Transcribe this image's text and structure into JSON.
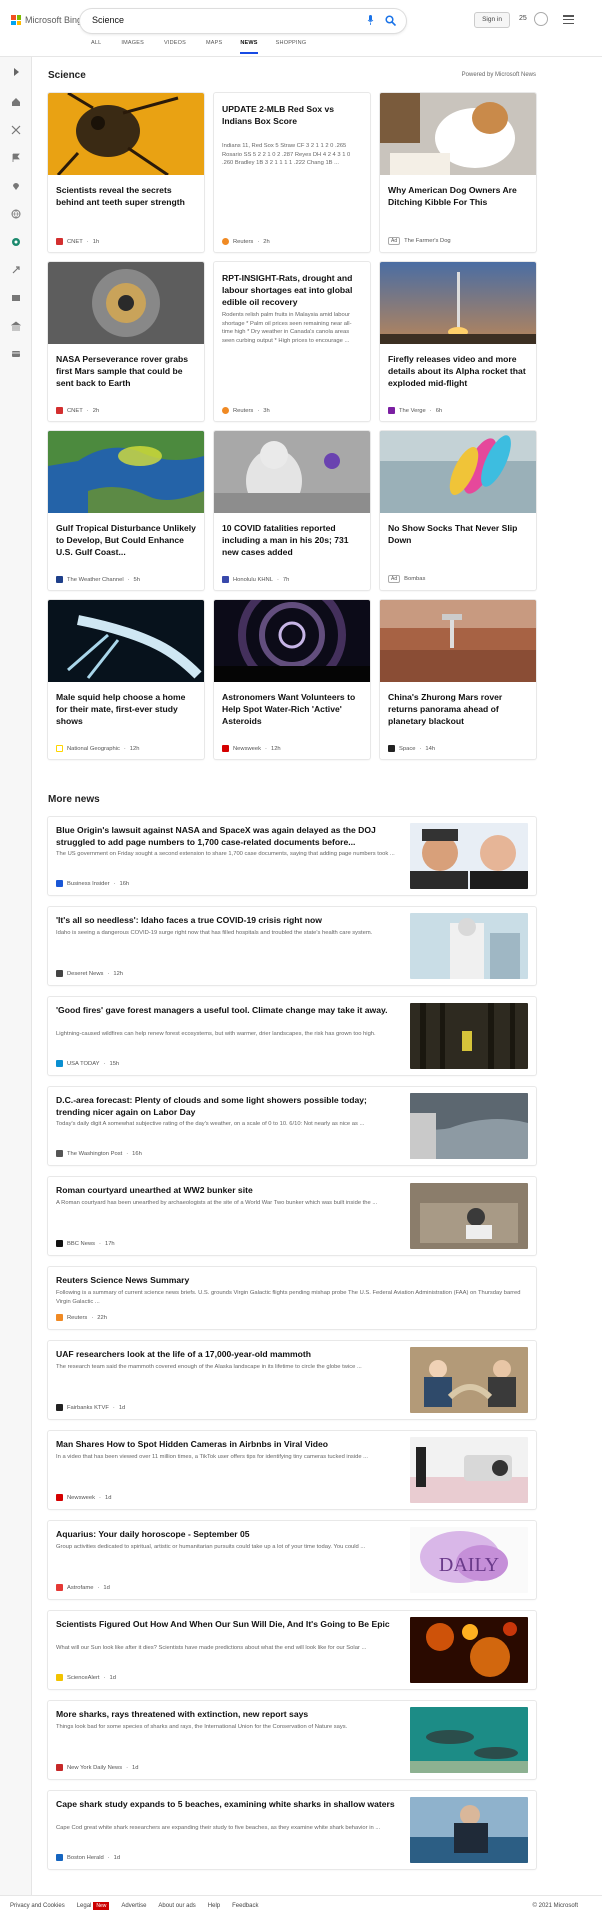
{
  "brand": {
    "name": "Microsoft Bing"
  },
  "search": {
    "query": "Science"
  },
  "header": {
    "signin": "Sign in",
    "rewards": "25"
  },
  "tabs": [
    "ALL",
    "IMAGES",
    "VIDEOS",
    "MAPS",
    "NEWS",
    "SHOPPING"
  ],
  "active_tab": "NEWS",
  "section": {
    "title": "Science",
    "powered": "Powered by Microsoft News"
  },
  "cards": [
    {
      "title": "Scientists reveal the secrets behind ant teeth super strength",
      "source": "CNET",
      "time": "1h",
      "icon_color": "#d32f2f"
    },
    {
      "title": "UPDATE 2-MLB Red Sox vs Indians Box Score",
      "snippet": "Indians 11, Red Sox 5 Straw CF 3 2 1 1 2 0 .265 Rosario SS 5 2 2 1 0 2 .287 Reyes DH 4 2 4 3 1 0 .260 Bradley 1B 3 2 1 1 1 1 .222 Chang 1B ...",
      "source": "Reuters",
      "time": "2h",
      "icon_color": "#f08a24"
    },
    {
      "title": "Why American Dog Owners Are Ditching Kibble For This",
      "ad": "Ad",
      "source": "The Farmer's Dog",
      "time": ""
    },
    {
      "title": "NASA Perseverance rover grabs first Mars sample that could be sent back to Earth",
      "source": "CNET",
      "time": "2h",
      "icon_color": "#d32f2f"
    },
    {
      "title": "RPT-INSIGHT-Rats, drought and labour shortages eat into global edible oil recovery",
      "snippet": "Rodents relish palm fruits in Malaysia amid labour shortage * Palm oil prices seen remaining near all-time high * Dry weather in Canada's canola areas seen curbing output * High prices to encourage ...",
      "source": "Reuters",
      "time": "3h",
      "icon_color": "#f08a24"
    },
    {
      "title": "Firefly releases video and more details about its Alpha rocket that exploded mid-flight",
      "source": "The Verge",
      "time": "6h",
      "icon_color": "#7b1fa2"
    },
    {
      "title": "Gulf Tropical Disturbance Unlikely to Develop, But Could Enhance U.S. Gulf Coast...",
      "source": "The Weather Channel",
      "time": "5h",
      "icon_color": "#1e3f8a"
    },
    {
      "title": "10 COVID fatalities reported including a man in his 20s; 731 new cases added",
      "source": "Honolulu KHNL",
      "time": "7h",
      "icon_color": "#3949ab"
    },
    {
      "title": "No Show Socks That Never Slip Down",
      "ad": "Ad",
      "source": "Bombas",
      "time": ""
    },
    {
      "title": "Male squid help choose a home for their mate, first-ever study shows",
      "source": "National Geographic",
      "time": "12h",
      "icon_color": "#ffd600"
    },
    {
      "title": "Astronomers Want Volunteers to Help Spot Water-Rich 'Active' Asteroids",
      "source": "Newsweek",
      "time": "12h",
      "icon_color": "#d50000"
    },
    {
      "title": "China's Zhurong Mars rover returns panorama ahead of planetary blackout",
      "source": "Space",
      "time": "14h",
      "icon_color": "#222222"
    }
  ],
  "more_news_title": "More news",
  "news": [
    {
      "title": "Blue Origin's lawsuit against NASA and SpaceX was again delayed as the DOJ struggled to add page numbers to 1,700 case-related documents before...",
      "snippet": "The US government on Friday sought a second extension to share 1,700 case documents, saying that adding page numbers took ...",
      "source": "Business Insider",
      "time": "16h",
      "icon_color": "#1a57d6"
    },
    {
      "title": "'It's all so needless': Idaho faces a true COVID-19 crisis right now",
      "snippet": "Idaho is seeing a dangerous COVID-19 surge right now that has filled hospitals and troubled the state's health care system.",
      "source": "Deseret News",
      "time": "12h",
      "icon_color": "#444444"
    },
    {
      "title": "'Good fires' gave forest managers a useful tool. Climate change may take it away.",
      "snippet": "Lightning-caused wildfires can help renew forest ecosystems, but with warmer, drier landscapes, the risk has grown too high.",
      "source": "USA TODAY",
      "time": "15h",
      "icon_color": "#0a8fd1"
    },
    {
      "title": "D.C.-area forecast: Plenty of clouds and some light showers possible today; trending nicer again on Labor Day",
      "snippet": "Today's daily digit A somewhat subjective rating of the day's weather, on a scale of 0 to 10. 6/10: Not nearly as nice as ...",
      "source": "The Washington Post",
      "time": "16h",
      "icon_color": "#555555"
    },
    {
      "title": "Roman courtyard unearthed at WW2 bunker site",
      "snippet": "A Roman courtyard has been unearthed by archaeologists at the site of a World War Two bunker which was built inside the ...",
      "source": "BBC News",
      "time": "17h",
      "icon_color": "#111111"
    },
    {
      "title": "Reuters Science News Summary",
      "snippet": "Following is a summary of current science news briefs. U.S. grounds Virgin Galactic flights pending mishap probe The U.S. Federal Aviation Administration (FAA) on Thursday barred Virgin Galactic ...",
      "source": "Reuters",
      "time": "22h",
      "icon_color": "#f08a24"
    },
    {
      "title": "UAF researchers look at the life of a 17,000-year-old mammoth",
      "snippet": "The research team said the mammoth covered enough of the Alaska landscape in its lifetime to circle the globe twice ...",
      "source": "Fairbanks KTVF",
      "time": "1d",
      "icon_color": "#222222"
    },
    {
      "title": "Man Shares How to Spot Hidden Cameras in Airbnbs in Viral Video",
      "snippet": "In a video that has been viewed over 11 million times, a TikTok user offers tips for identifying tiny cameras tucked inside ...",
      "source": "Newsweek",
      "time": "1d",
      "icon_color": "#d50000"
    },
    {
      "title": "Aquarius: Your daily horoscope - September 05",
      "snippet": "Group activities dedicated to spiritual, artistic or humanitarian pursuits could take up a lot of your time today. You could ...",
      "source": "Astrofame",
      "time": "1d",
      "icon_color": "#e53935"
    },
    {
      "title": "Scientists Figured Out How And When Our Sun Will Die, And It's Going to Be Epic",
      "snippet": "What will our Sun look like after it dies? Scientists have made predictions about what the end will look like for our Solar ...",
      "source": "ScienceAlert",
      "time": "1d",
      "icon_color": "#f2c300"
    },
    {
      "title": "More sharks, rays threatened with extinction, new report says",
      "snippet": "Things look bad for some species of sharks and rays, the International Union for the Conservation of Nature says.",
      "source": "New York Daily News",
      "time": "1d",
      "icon_color": "#c62828"
    },
    {
      "title": "Cape shark study expands to 5 beaches, examining white sharks in shallow waters",
      "snippet": "Cape Cod great white shark researchers are expanding their study to five beaches, as they examine white shark behavior in ...",
      "source": "Boston Herald",
      "time": "1d",
      "icon_color": "#1565c0"
    }
  ],
  "footer": {
    "privacy": "Privacy and Cookies",
    "legal": "Legal",
    "new": "New",
    "advertise": "Advertise",
    "about_ads": "About our ads",
    "help": "Help",
    "feedback": "Feedback",
    "copyright": "© 2021 Microsoft"
  }
}
